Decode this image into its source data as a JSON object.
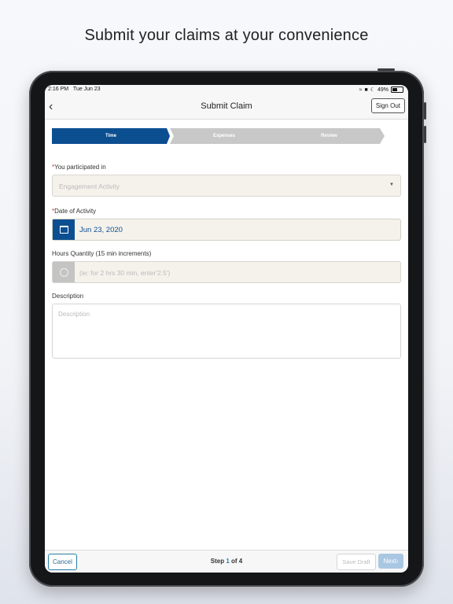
{
  "headline": "Submit your claims at your convenience",
  "status_bar": {
    "time": "2:16 PM",
    "date": "Tue Jun 23",
    "battery": "49%"
  },
  "nav": {
    "back_icon": "chevron-left-icon",
    "title": "Submit Claim",
    "sign_out": "Sign Out"
  },
  "steps": [
    "Time",
    "Expenses",
    "Review"
  ],
  "form": {
    "participated": {
      "label": "You participated in",
      "placeholder": "Engagement Activity"
    },
    "date": {
      "label": "Date of Activity",
      "value": "Jun 23, 2020"
    },
    "hours": {
      "label": "Hours Quantity (15 min increments)",
      "placeholder": "(ie: for 2 hrs 30 min, enter'2.5')"
    },
    "description": {
      "label": "Description",
      "placeholder": "Description"
    }
  },
  "footer": {
    "cancel": "Cancel",
    "step_prefix": "Step",
    "step_current": "1",
    "step_of": "of 4",
    "save_draft": "Save Draft",
    "next": "Next"
  },
  "colors": {
    "primary": "#0c4f91",
    "inactive_step": "#c8c8c8",
    "required": "#c23934"
  }
}
